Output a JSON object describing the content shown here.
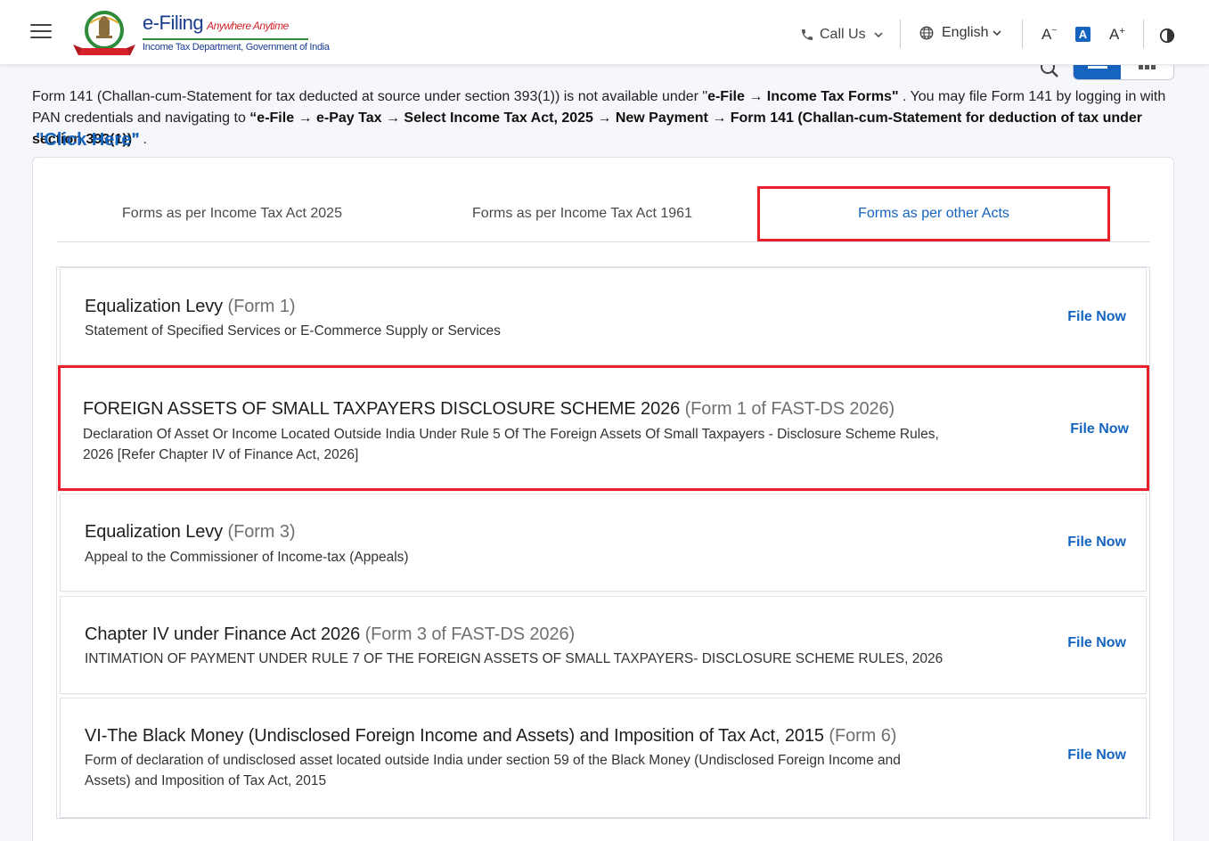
{
  "header": {
    "logo_main": "e-Filing",
    "logo_tagline": "Anywhere Anytime",
    "logo_sub": "Income Tax Department, Government of India",
    "emblem_text": "INCOME TAX DEPARTMENT",
    "call_us": "Call Us",
    "language": "English",
    "font_decrease": "A",
    "font_default": "A",
    "font_increase": "A"
  },
  "notice": {
    "part1": "Form 141 (Challan-cum-Statement for tax deducted at source under section 393(1)) is not available under \"",
    "bold1": "e-File → Income Tax Forms\"",
    "part2": " . You may file Form 141 by logging in with PAN credentials and navigating to ",
    "bold2": "“e-File → e-Pay Tax → Select Income Tax Act, 2025 → New Payment → Form 141 (Challan-cum-Statement for deduction of tax under section 393(1))”",
    "part3": " .",
    "click_here": "\"Click Here\""
  },
  "tabs": [
    {
      "label": "Forms as per Income Tax Act 2025"
    },
    {
      "label": "Forms as per Income Tax Act 1961"
    },
    {
      "label": "Forms as per other Acts"
    }
  ],
  "forms": [
    {
      "title": "Equalization Levy",
      "form": "(Form 1)",
      "desc": "Statement of Specified Services or E-Commerce Supply or Services",
      "action": "File Now"
    },
    {
      "title": "FOREIGN ASSETS OF SMALL TAXPAYERS DISCLOSURE SCHEME 2026",
      "form": "(Form 1 of FAST-DS 2026)",
      "desc": "Declaration Of Asset Or Income Located Outside India Under Rule 5 Of The Foreign Assets Of Small Taxpayers - Disclosure Scheme Rules, 2026 [Refer Chapter IV of Finance Act, 2026]",
      "action": "File Now"
    },
    {
      "title": "Equalization Levy",
      "form": "(Form 3)",
      "desc": "Appeal to the Commissioner of Income-tax (Appeals)",
      "action": "File Now"
    },
    {
      "title": "Chapter IV under Finance Act 2026",
      "form": "(Form 3 of FAST-DS 2026)",
      "desc": "INTIMATION OF PAYMENT UNDER RULE 7 OF THE FOREIGN ASSETS OF SMALL TAXPAYERS- DISCLOSURE SCHEME RULES, 2026",
      "action": "File Now"
    },
    {
      "title": "VI-The Black Money (Undisclosed Foreign Income and Assets) and Imposition of Tax Act, 2015",
      "form": "(Form 6)",
      "desc": "Form of declaration of undisclosed asset located outside India under section 59 of the Black Money (Undisclosed Foreign Income and Assets) and Imposition of Tax Act, 2015",
      "action": "File Now"
    }
  ],
  "colors": {
    "accent": "#1565c0",
    "highlight": "#e8202c"
  }
}
